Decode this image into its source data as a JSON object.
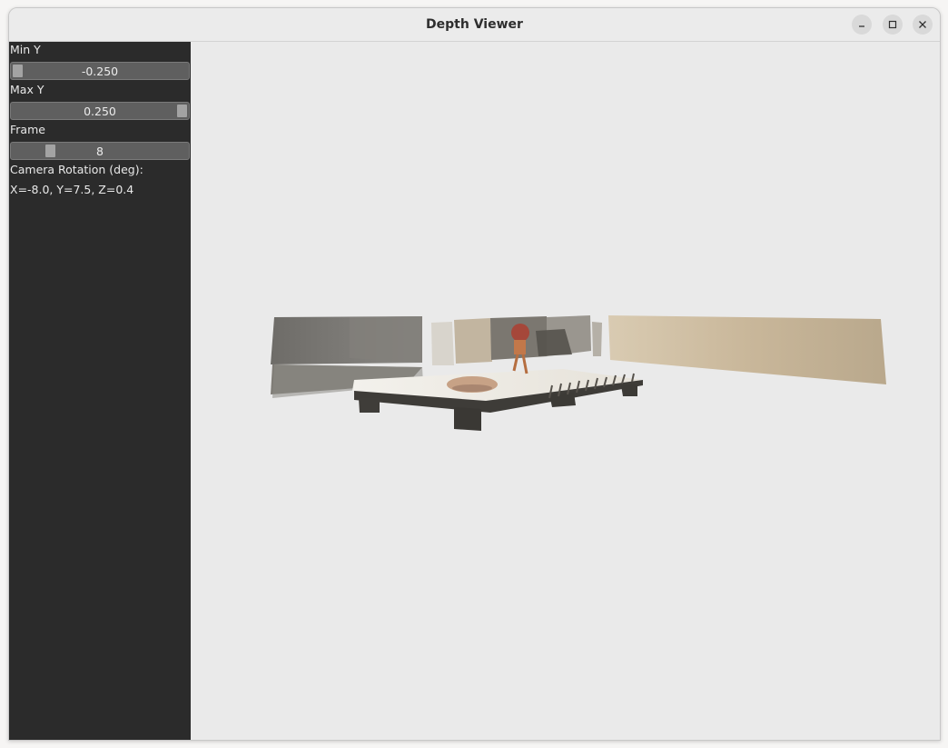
{
  "window": {
    "title": "Depth Viewer",
    "controls": {
      "minimize_icon": "minimize-icon",
      "maximize_icon": "maximize-icon",
      "close_icon": "close-icon"
    }
  },
  "sidebar": {
    "min_y": {
      "label": "Min Y",
      "value": "-0.250",
      "position": 0.0
    },
    "max_y": {
      "label": "Max Y",
      "value": "0.250",
      "position": 1.0
    },
    "frame": {
      "label": "Frame",
      "value": "8",
      "position": 0.2
    },
    "camera_rotation": {
      "label": "Camera Rotation (deg):",
      "value": "X=-8.0, Y=7.5, Z=0.4"
    }
  },
  "viewport": {
    "background": "#eaeaea",
    "content": "point-cloud"
  }
}
